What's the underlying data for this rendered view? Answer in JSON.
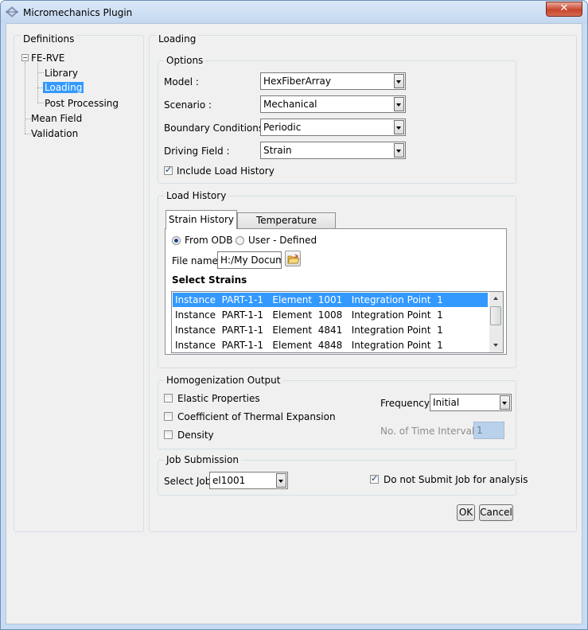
{
  "window": {
    "title": "Micromechanics Plugin",
    "close_glyph": "✕"
  },
  "definitions": {
    "label": "Definitions",
    "tree": {
      "fe_rve": "FE-RVE",
      "library": "Library",
      "loading": "Loading",
      "post_processing": "Post Processing",
      "mean_field": "Mean Field",
      "validation": "Validation"
    },
    "expander_glyph": "−"
  },
  "loading": {
    "label": "Loading",
    "options": {
      "label": "Options",
      "model_label": "Model :",
      "model_value": "HexFiberArray",
      "scenario_label": "Scenario :",
      "scenario_value": "Mechanical",
      "bc_label": "Boundary Conditions :",
      "bc_value": "Periodic",
      "driving_label": "Driving Field :",
      "driving_value": "Strain",
      "include_history_label": "Include Load History",
      "include_history_checked": true
    },
    "load_history": {
      "label": "Load History",
      "tabs": [
        "Strain History",
        "Temperature History"
      ],
      "from_odb_label": "From ODB",
      "user_defined_label": "User - Defined",
      "file_name_label": "File name:",
      "file_name_value": "H:/My Docum",
      "select_strains_label": "Select Strains",
      "strains": [
        "Instance  PART-1-1   Element  1001   Integration Point  1",
        "Instance  PART-1-1   Element  1008   Integration Point  1",
        "Instance  PART-1-1   Element  4841   Integration Point  1",
        "Instance  PART-1-1   Element  4848   Integration Point  1"
      ]
    },
    "homogenization": {
      "label": "Homogenization Output",
      "elastic_label": "Elastic Properties",
      "cte_label": "Coefficient of Thermal Expansion",
      "density_label": "Density",
      "frequency_label": "Frequency:",
      "frequency_value": "Initial",
      "intervals_label": "No. of Time Intervals:",
      "intervals_value": "1"
    },
    "job": {
      "label": "Job Submission",
      "select_job_label": "Select Job:",
      "select_job_value": "el1001",
      "no_submit_label": "Do not Submit Job for analysis",
      "no_submit_checked": true
    },
    "ok_label": "OK",
    "cancel_label": "Cancel"
  },
  "colors": {
    "selection": "#3399ff",
    "frame": "#c7dcf3",
    "dialog": "#f0f0f0"
  }
}
